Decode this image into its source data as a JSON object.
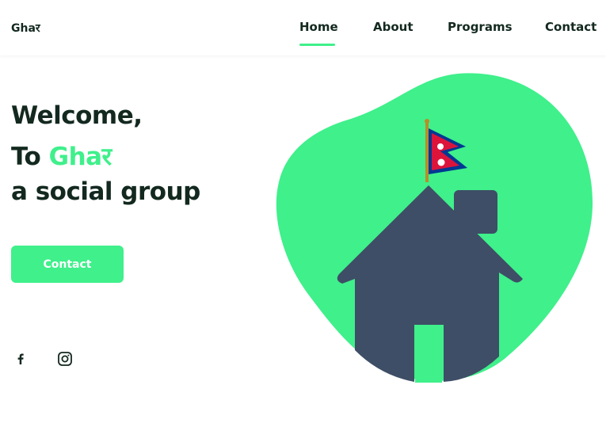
{
  "header": {
    "logo": "Ghaर",
    "nav": {
      "home": "Home",
      "about": "About",
      "programs": "Programs",
      "contact": "Contact"
    }
  },
  "hero": {
    "line1": "Welcome,",
    "line2_prefix": "To ",
    "line2_brand": "Ghaर",
    "line3": "a social group",
    "cta_label": "Contact"
  },
  "social": {
    "icons": [
      "facebook-icon",
      "instagram-icon"
    ]
  },
  "colors": {
    "accent": "#3ff08b",
    "text": "#13291f",
    "house": "#3e4e66",
    "flag_red": "#dc143c",
    "flag_blue": "#003893"
  }
}
